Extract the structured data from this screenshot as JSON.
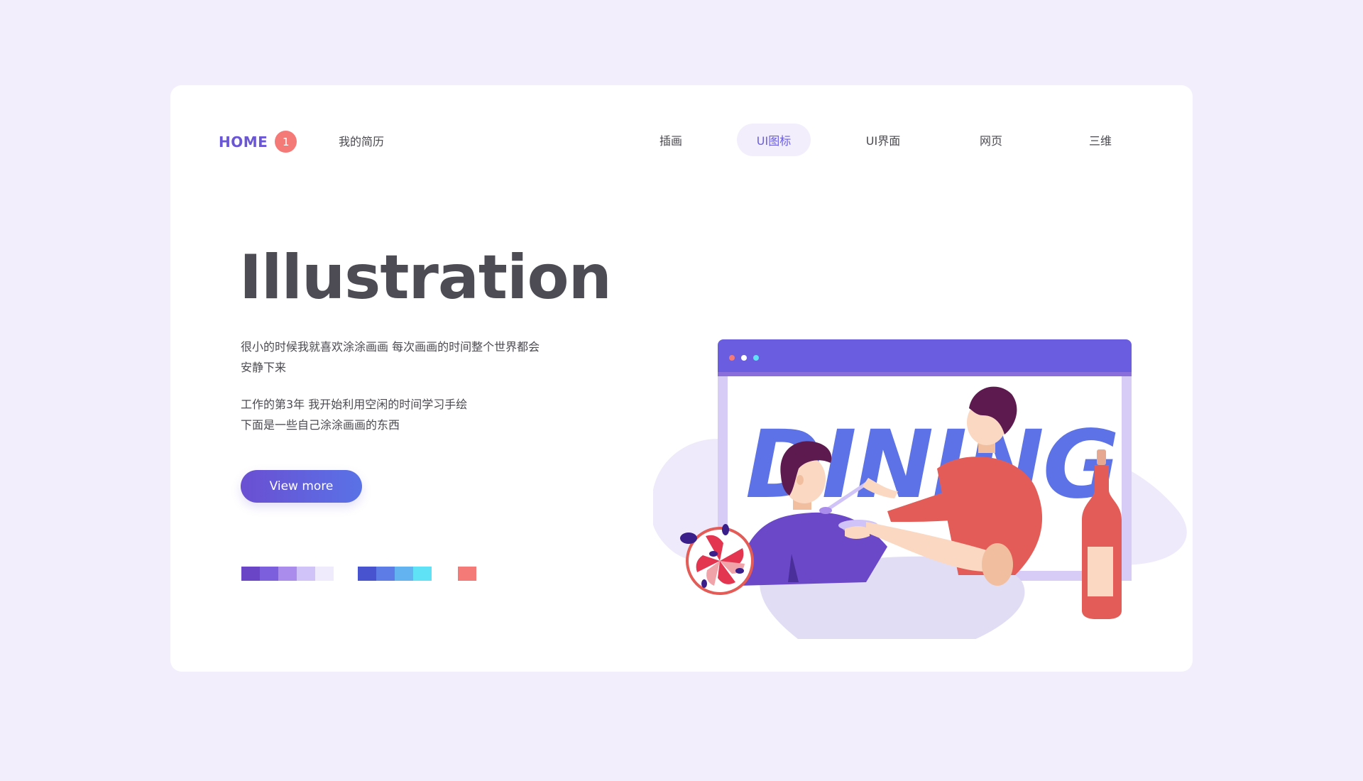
{
  "nav": {
    "home_label": "HOME",
    "home_badge": "1",
    "resume_label": "我的简历",
    "tabs": [
      {
        "label": "插画",
        "active": false
      },
      {
        "label": "UI图标",
        "active": true
      },
      {
        "label": "UI界面",
        "active": false
      },
      {
        "label": "网页",
        "active": false
      },
      {
        "label": "三维",
        "active": false
      }
    ]
  },
  "hero": {
    "title": "Illustration",
    "paragraph1_line1": "很小的时候我就喜欢涂涂画画 每次画画的时间整个世界都会",
    "paragraph1_line2": "安静下来",
    "paragraph2_line1": "工作的第3年 我开始利用空闲的时间学习手绘",
    "paragraph2_line2": "下面是一些自己涂涂画画的东西",
    "button_label": "View more"
  },
  "palette": {
    "purples": [
      "#6a46c6",
      "#7b5fdc",
      "#a98cec",
      "#cfc3f7",
      "#efebfd"
    ],
    "blues": [
      "#4753cf",
      "#5e7ce6",
      "#62b3f0",
      "#5fe1f6"
    ],
    "accent": [
      "#f47a78"
    ]
  },
  "illustration": {
    "window_text": "DINING",
    "colors": {
      "window_bar": "#6a5de0",
      "window_frame": "#d6ccf6",
      "text": "#5c72e6",
      "shirt_red": "#e45c57",
      "shirt_purple": "#6b48c8",
      "hair": "#5c1a4e",
      "skin": "#fbd8c2",
      "blob": "#eeeafb",
      "table": "#e1ddf4"
    }
  }
}
